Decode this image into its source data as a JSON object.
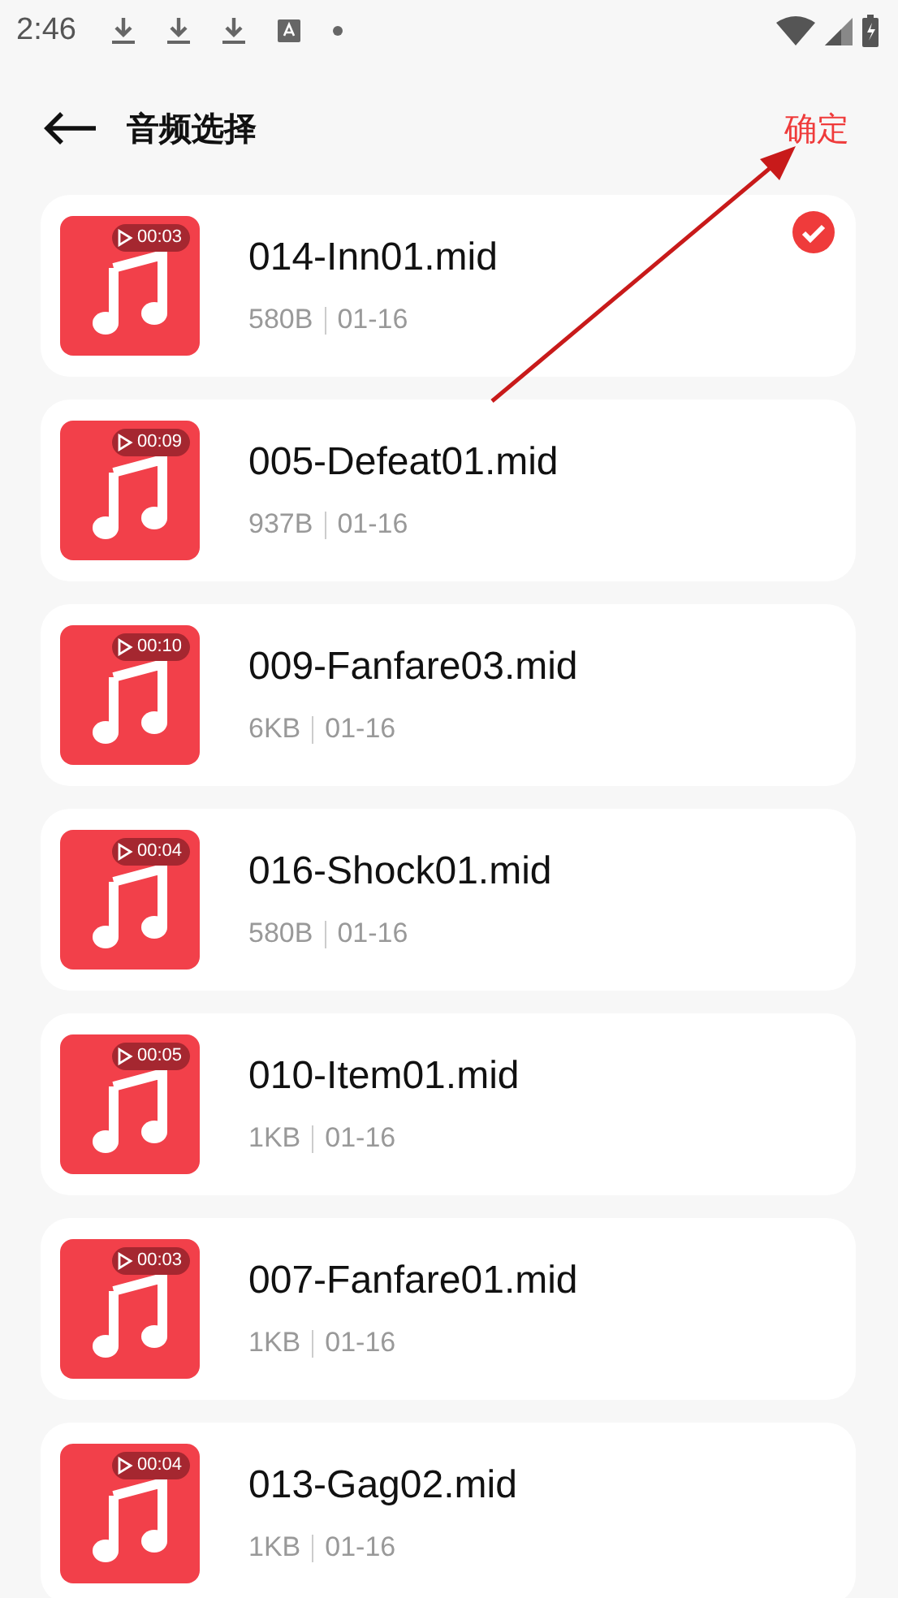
{
  "status_bar": {
    "time": "2:46",
    "notifications": [
      {
        "kind": "download"
      },
      {
        "kind": "download"
      },
      {
        "kind": "download"
      },
      {
        "kind": "keyboard"
      },
      {
        "kind": "dot"
      }
    ]
  },
  "header": {
    "title": "音频选择",
    "confirm": "确定"
  },
  "files": [
    {
      "name": "014-Inn01.mid",
      "duration": "00:03",
      "size": "580B",
      "date": "01-16",
      "selected": true
    },
    {
      "name": "005-Defeat01.mid",
      "duration": "00:09",
      "size": "937B",
      "date": "01-16",
      "selected": false
    },
    {
      "name": "009-Fanfare03.mid",
      "duration": "00:10",
      "size": "6KB",
      "date": "01-16",
      "selected": false
    },
    {
      "name": "016-Shock01.mid",
      "duration": "00:04",
      "size": "580B",
      "date": "01-16",
      "selected": false
    },
    {
      "name": "010-Item01.mid",
      "duration": "00:05",
      "size": "1KB",
      "date": "01-16",
      "selected": false
    },
    {
      "name": "007-Fanfare01.mid",
      "duration": "00:03",
      "size": "1KB",
      "date": "01-16",
      "selected": false
    },
    {
      "name": "013-Gag02.mid",
      "duration": "00:04",
      "size": "1KB",
      "date": "01-16",
      "selected": false
    }
  ],
  "annotation": {
    "kind": "arrow"
  }
}
